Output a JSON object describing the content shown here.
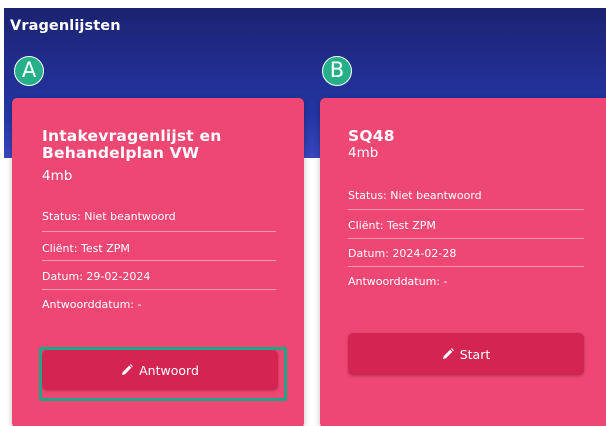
{
  "page": {
    "title": "Vragenlijsten"
  },
  "markers": [
    "A",
    "B"
  ],
  "cards": [
    {
      "title_line1": "Intakevragenlijst en",
      "title_line2": "Behandelplan VW",
      "subtitle": "4mb",
      "fields": [
        "Status: Niet beantwoord",
        "Cliënt: Test ZPM",
        "Datum: 29-02-2024",
        "Antwoorddatum: -"
      ],
      "button_label": "Antwoord",
      "button_icon": "pencil-icon"
    },
    {
      "title_line1": "SQ48",
      "subtitle": "4mb",
      "fields": [
        "Status: Niet beantwoord",
        "Cliënt: Test ZPM",
        "Datum: 2024-02-28",
        "Antwoorddatum: -"
      ],
      "button_label": "Start",
      "button_icon": "pencil-icon"
    }
  ],
  "colors": {
    "header_bg": "#1f2a86",
    "card_bg": "#ef4773",
    "button_bg": "#d42451",
    "marker_bg": "#26b08a",
    "highlight_border": "#1ea688"
  }
}
